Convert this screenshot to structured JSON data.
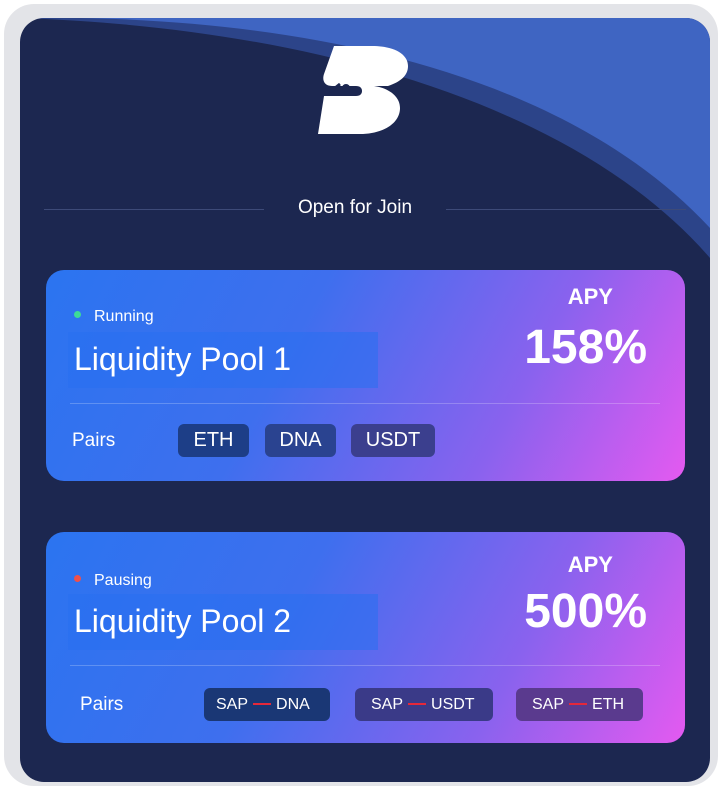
{
  "header": {
    "logo_icon": "brand-s-logo-icon",
    "section_title": "Open for Join"
  },
  "pools": [
    {
      "status": "Running",
      "status_color": "#3ddc97",
      "name": "Liquidity Pool 1",
      "apy_label": "APY",
      "apy_value": "158%",
      "pairs_label": "Pairs",
      "tokens": [
        "ETH",
        "DNA",
        "USDT"
      ]
    },
    {
      "status": "Pausing",
      "status_color": "#f0504a",
      "name": "Liquidity Pool 2",
      "apy_label": "APY",
      "apy_value": "500%",
      "pairs_label": "Pairs",
      "pairs": [
        {
          "from": "SAP",
          "to": "DNA"
        },
        {
          "from": "SAP",
          "to": "USDT"
        },
        {
          "from": "SAP",
          "to": "ETH"
        }
      ]
    }
  ],
  "colors": {
    "background": "#1c2750",
    "card_gradient_start": "#2b74f0",
    "card_gradient_end": "#e45af0",
    "pair_connector": "#e5283a"
  }
}
